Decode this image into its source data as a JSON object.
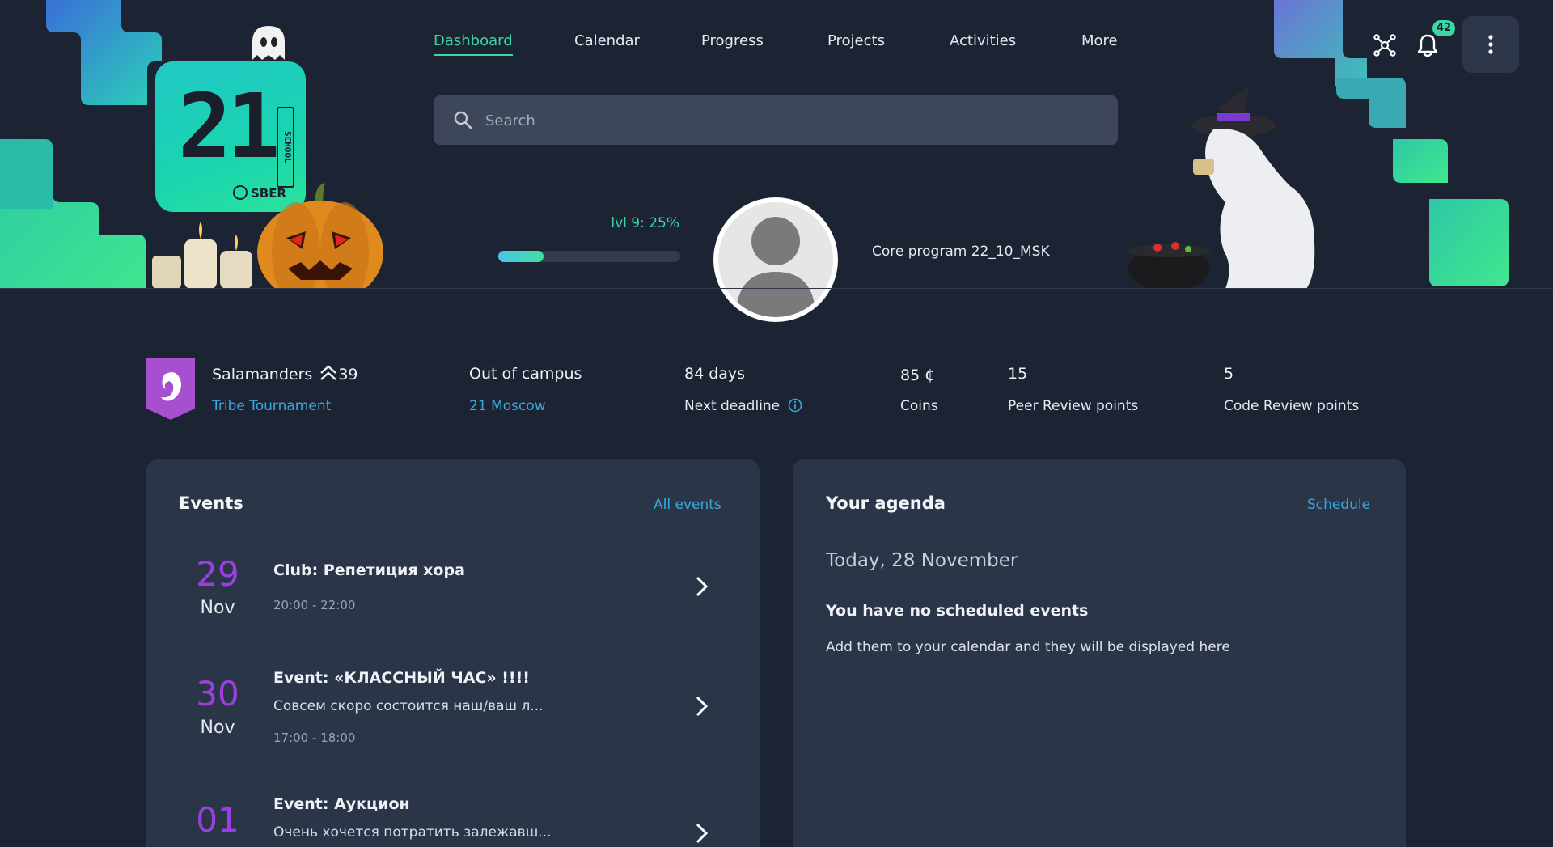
{
  "logo": {
    "digits": "21",
    "school": "SCHOOL",
    "brand": "SBER"
  },
  "nav": {
    "items": [
      {
        "label": "Dashboard",
        "active": true
      },
      {
        "label": "Calendar",
        "active": false
      },
      {
        "label": "Progress",
        "active": false
      },
      {
        "label": "Projects",
        "active": false
      },
      {
        "label": "Activities",
        "active": false
      },
      {
        "label": "More",
        "active": false
      }
    ]
  },
  "search": {
    "placeholder": "Search",
    "value": ""
  },
  "header_actions": {
    "network_icon": "network-icon",
    "bell_icon": "bell-icon",
    "notifications_count": "42",
    "menu_icon": "kebab-menu-icon"
  },
  "profile": {
    "level_label": "lvl 9: 25%",
    "level_progress": 0.25,
    "program": "Core program 22_10_MSK",
    "avatar_icon": "user-silhouette-icon"
  },
  "stats": {
    "tribe_name": "Salamanders",
    "tribe_rank": "39",
    "tribe_link": "Tribe Tournament",
    "campus_status": "Out of campus",
    "campus_link": "21 Moscow",
    "deadline_days": "84 days",
    "deadline_label": "Next deadline",
    "coins_value": "85 ₵",
    "coins_label": "Coins",
    "peer_value": "15",
    "peer_label": "Peer Review points",
    "code_value": "5",
    "code_label": "Code Review points"
  },
  "events": {
    "title": "Events",
    "link": "All events",
    "items": [
      {
        "day": "29",
        "month": "Nov",
        "title": "Club: Репетиция хора",
        "description": "",
        "time": "20:00 - 22:00"
      },
      {
        "day": "30",
        "month": "Nov",
        "title": "Event: «КЛАССНЫЙ ЧАС» !!!!",
        "description": "Совсем скоро состоится наш/ваш л...",
        "time": "17:00 - 18:00"
      },
      {
        "day": "01",
        "month": "",
        "title": "Event: Аукцион",
        "description": "Очень хочется потратить залежавш...",
        "time": ""
      }
    ]
  },
  "agenda": {
    "title": "Your agenda",
    "link": "Schedule",
    "date": "Today, 28 November",
    "empty_title": "You have no scheduled events",
    "empty_hint": "Add them to your calendar and they will be displayed here"
  },
  "colors": {
    "background": "#1c2433",
    "card": "#2b3548",
    "accent_green": "#3fd6a6",
    "link_blue": "#3aa8e0",
    "date_purple": "#9b3fe0",
    "tribe_purple": "#a64fcf"
  }
}
